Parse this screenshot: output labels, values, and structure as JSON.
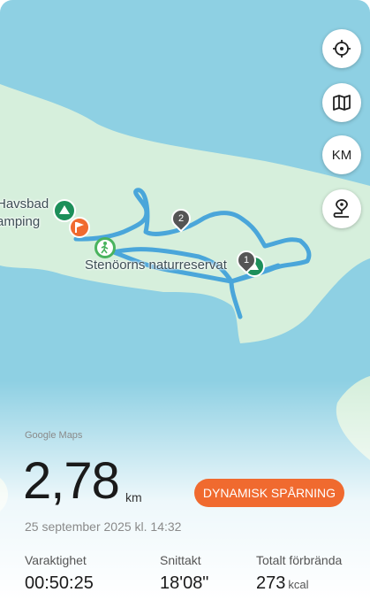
{
  "map": {
    "controls": [
      {
        "name": "locate-button",
        "icon": "crosshair-icon"
      },
      {
        "name": "map-layers-button",
        "icon": "map-icon"
      },
      {
        "name": "units-button",
        "label": "KM"
      },
      {
        "name": "route-button",
        "icon": "route-icon"
      }
    ],
    "labels": {
      "camping_line1": "Havsbad",
      "camping_line2": "amping",
      "reserve": "Stenöorns naturreservat"
    },
    "markers": {
      "waypoint_1": "1",
      "waypoint_2": "2"
    },
    "colors": {
      "water": "#8ed0e3",
      "land": "#d6efdc",
      "route": "#4aa6da",
      "camping": "#1d8f5a",
      "flag": "#f06a2f",
      "walker": "#49b35e"
    }
  },
  "stats": {
    "attribution": "Google Maps",
    "distance": "2,78",
    "distance_unit": "km",
    "tracking_button": "DYNAMISK SPÅRNING",
    "date": "25 september 2025 kl. 14:32",
    "duration_label": "Varaktighet",
    "duration_value": "00:50:25",
    "pace_label": "Snittakt",
    "pace_value": "18'08\"",
    "calories_label": "Totalt förbrända",
    "calories_value": "273",
    "calories_unit": "kcal"
  }
}
